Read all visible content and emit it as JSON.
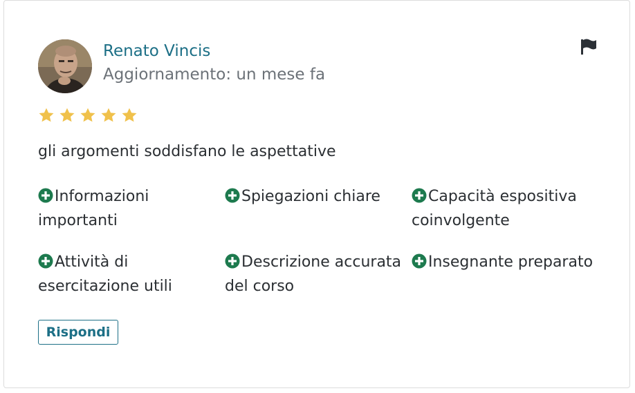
{
  "review": {
    "author": "Renato Vincis",
    "updated": "Aggiornamento: un mese fa",
    "rating": 5,
    "rating_max": 5,
    "comment": "gli argomenti soddisfano le aspettative",
    "tags": [
      {
        "label": "Informazioni importanti"
      },
      {
        "label": "Spiegazioni chiare"
      },
      {
        "label": "Capacità espositiva coinvolgente"
      },
      {
        "label": "Attività di esercitazione utili"
      },
      {
        "label": "Descrizione accurata del corso"
      },
      {
        "label": "Insegnante preparato"
      }
    ],
    "reply_label": "Rispondi"
  },
  "colors": {
    "accent": "#1c6f86",
    "star": "#f0c14b",
    "tag_icon": "#1d7a4e",
    "flag": "#2b3036"
  },
  "icons": {
    "avatar": "user-photo",
    "flag": "flag-icon",
    "star": "star-icon",
    "tag": "plus-circle-icon"
  }
}
